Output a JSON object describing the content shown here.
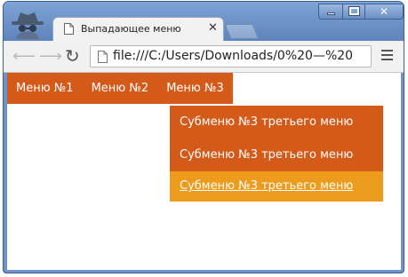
{
  "browser": {
    "tab_title": "Выпадающее меню",
    "tab_close": "✕",
    "address": "file:///C:/Users/Downloads/0%20—%20"
  },
  "page": {
    "menu": [
      {
        "label": "Меню №1"
      },
      {
        "label": "Меню №2"
      },
      {
        "label": "Меню №3"
      }
    ],
    "submenu": [
      {
        "label": "Субменю №3 третьего меню",
        "state": "normal"
      },
      {
        "label": "Субменю №3 третьего меню",
        "state": "normal"
      },
      {
        "label": "Субменю №3 третьего меню",
        "state": "hover"
      }
    ]
  },
  "colors": {
    "menu_bg": "#d45a1a",
    "submenu_hover_bg": "#ec9b1c",
    "titlebar": "#6f93c8"
  },
  "icons": [
    "incognito-icon",
    "page-icon",
    "close-icon",
    "back-arrow-icon",
    "forward-arrow-icon",
    "reload-icon",
    "document-icon",
    "hamburger-menu-icon"
  ]
}
